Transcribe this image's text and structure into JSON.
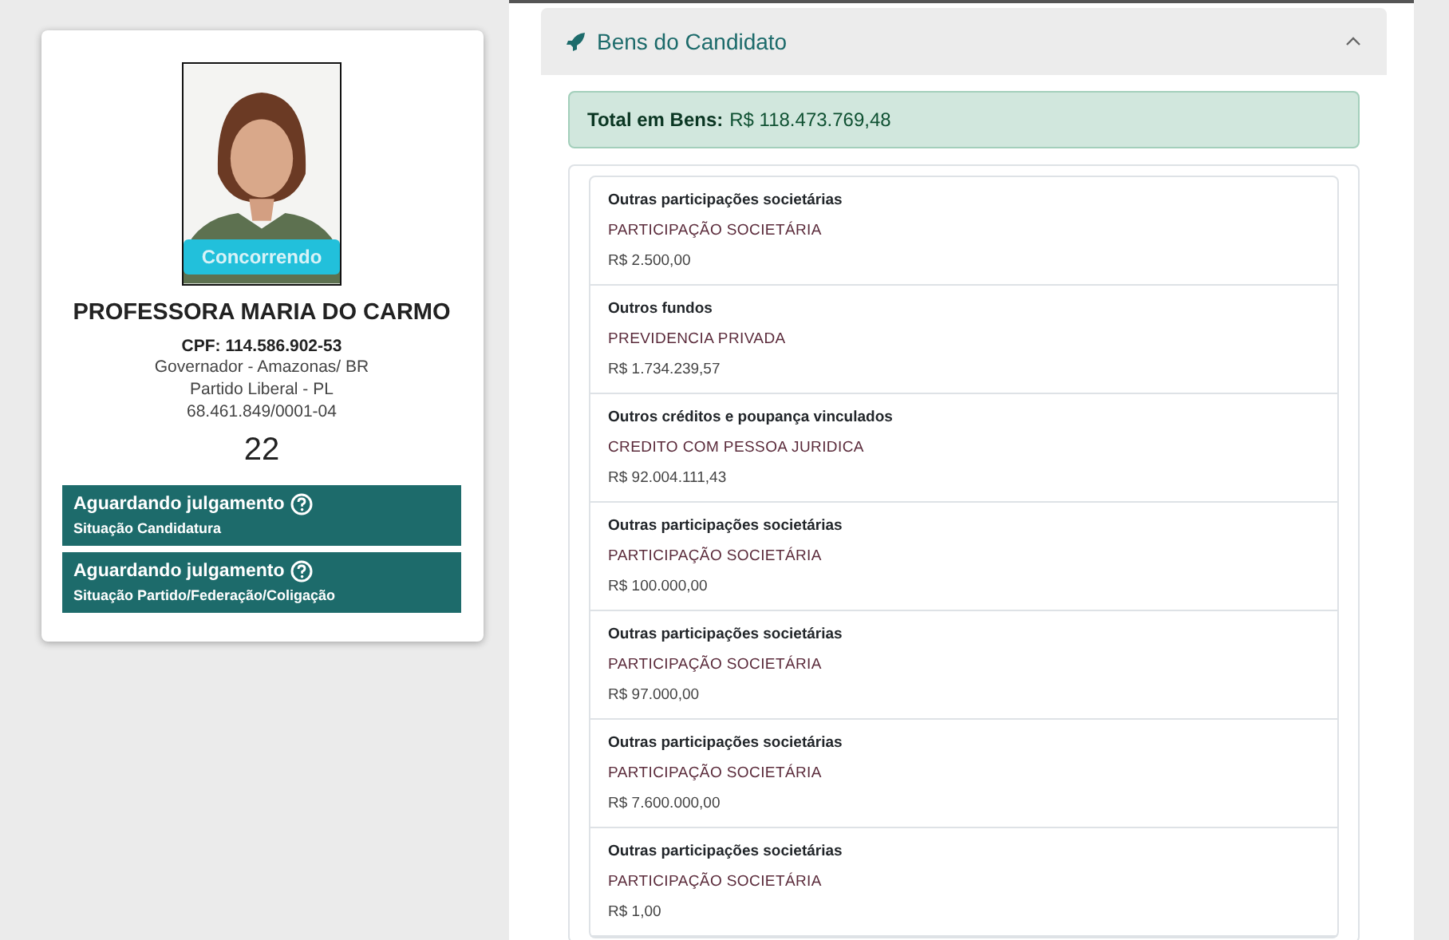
{
  "candidate": {
    "status_badge": "Concorrendo",
    "name": "PROFESSORA MARIA DO CARMO",
    "cpf": "CPF: 114.586.902-53",
    "office": "Governador - Amazonas/ BR",
    "party": "Partido Liberal - PL",
    "cnpj": "68.461.849/0001-04",
    "number": "22",
    "situations": [
      {
        "title": "Aguardando julgamento",
        "subtitle": "Situação Candidatura"
      },
      {
        "title": "Aguardando julgamento",
        "subtitle": "Situação Partido/Federação/Coligação"
      }
    ]
  },
  "assets_panel": {
    "title": "Bens do Candidato",
    "expanded": true,
    "total_label": "Total em Bens:",
    "total_value": "R$ 118.473.769,48",
    "items": [
      {
        "type": "Outras participações societárias",
        "description": "PARTICIPAÇÃO SOCIETÁRIA",
        "value": "R$ 2.500,00"
      },
      {
        "type": "Outros fundos",
        "description": "PREVIDENCIA PRIVADA",
        "value": "R$ 1.734.239,57"
      },
      {
        "type": "Outros créditos e poupança vinculados",
        "description": "CREDITO COM PESSOA JURIDICA",
        "value": "R$ 92.004.111,43"
      },
      {
        "type": "Outras participações societárias",
        "description": "PARTICIPAÇÃO SOCIETÁRIA",
        "value": "R$ 100.000,00"
      },
      {
        "type": "Outras participações societárias",
        "description": "PARTICIPAÇÃO SOCIETÁRIA",
        "value": "R$ 97.000,00"
      },
      {
        "type": "Outras participações societárias",
        "description": "PARTICIPAÇÃO SOCIETÁRIA",
        "value": "R$ 7.600.000,00"
      },
      {
        "type": "Outras participações societárias",
        "description": "PARTICIPAÇÃO SOCIETÁRIA",
        "value": "R$ 1,00"
      }
    ]
  }
}
